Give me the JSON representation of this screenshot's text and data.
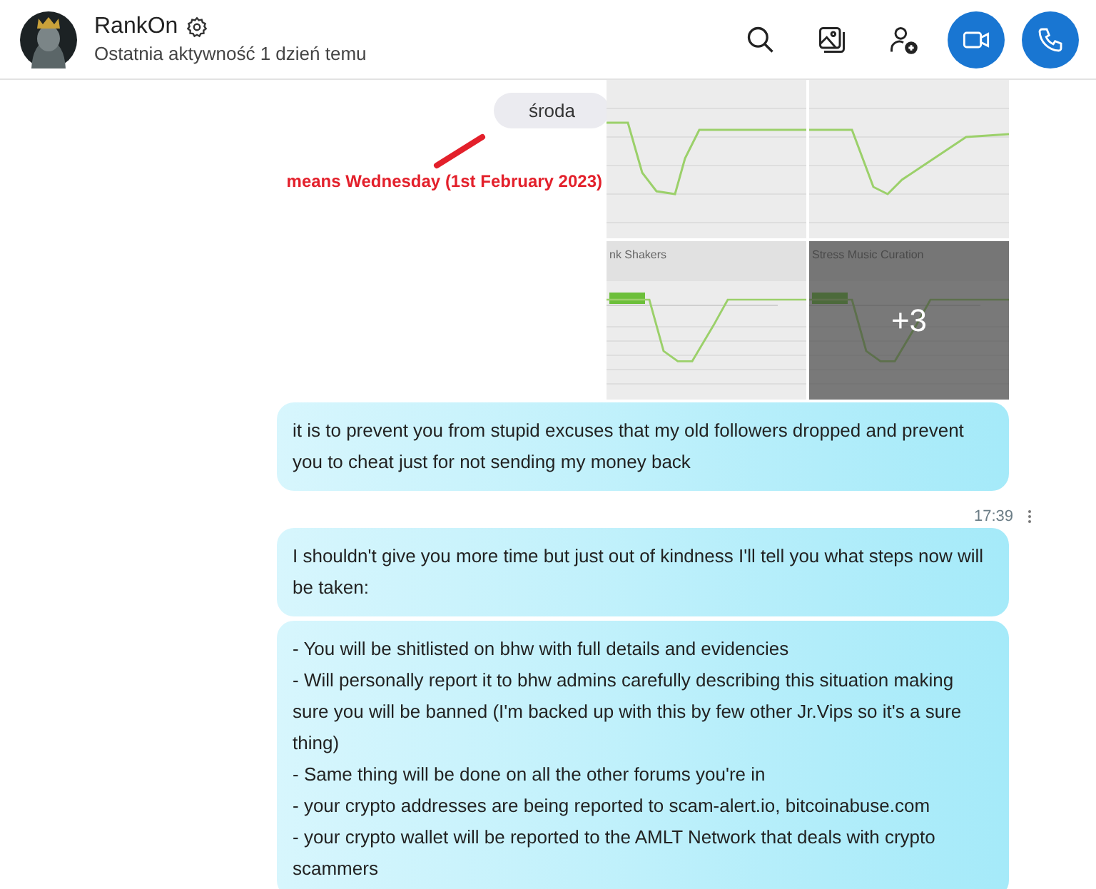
{
  "header": {
    "name": "RankOn",
    "status": "Ostatnia aktywność 1 dzień temu"
  },
  "day_label": "środa",
  "annotation": "means Wednesday (1st February 2023)",
  "thumbnails": [
    {
      "kind": "picture"
    },
    {
      "kind": "picture"
    },
    {
      "kind": "picture",
      "title": "nk Shakers"
    },
    {
      "kind": "picture",
      "title": "Stress Music Curation",
      "more": "+3"
    }
  ],
  "messages": [
    {
      "text": "it is to prevent you from stupid excuses that my old followers dropped and prevent you to cheat just for not sending my money back"
    },
    {
      "time": "17:39",
      "text": "I shouldn't give you more time but just out of kindness I'll tell you what steps now will be taken:"
    },
    {
      "text": "- You will be shitlisted on bhw with full details and evidencies\n- Will personally report it to bhw admins carefully describing this situation making sure you will be banned (I'm backed up with this by few other Jr.Vips so it's a sure thing)\n- Same thing will be done on all the other forums you're in\n- your crypto addresses are being reported to scam-alert.io, bitcoinabuse.com\n- your crypto wallet will be reported to the AMLT Network that deals with crypto scammers"
    }
  ]
}
